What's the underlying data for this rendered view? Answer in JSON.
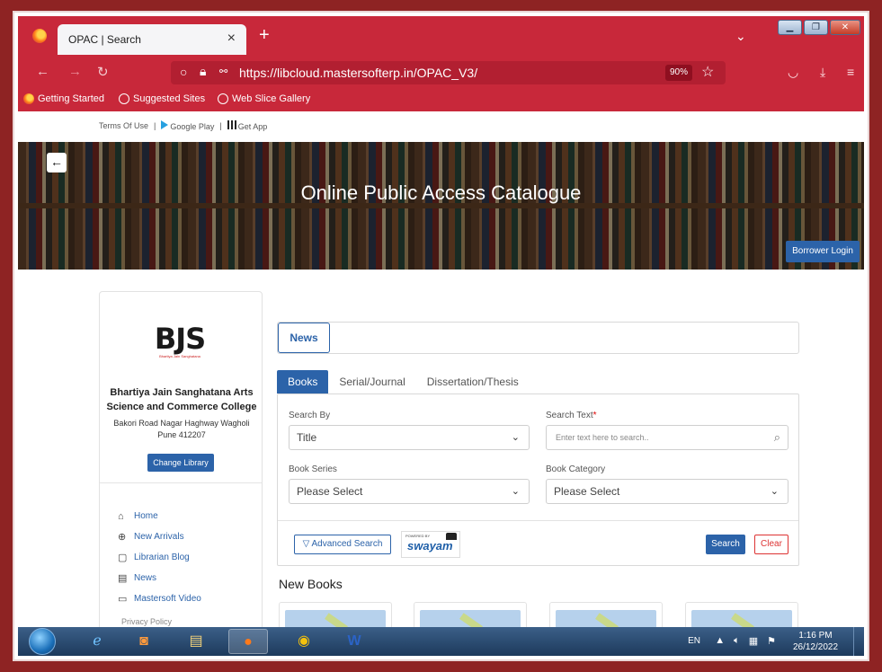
{
  "browser": {
    "tab_title": "OPAC | Search",
    "tab_close": "×",
    "new_tab": "+",
    "url": "https://libcloud.mastersofterp.in/OPAC_V3/",
    "zoom": "90%",
    "bookmarks": [
      "Getting Started",
      "Suggested Sites",
      "Web Slice Gallery"
    ],
    "colors": {
      "chrome": "#c8283a",
      "url_bg": "#b21f31"
    }
  },
  "topbar": {
    "terms": "Terms Of Use",
    "separator": "|",
    "google_play": "Google Play",
    "get_app": "Get App"
  },
  "hero": {
    "title": "Online Public Access Catalogue",
    "back": "←",
    "borrower_login": "Borrower Login"
  },
  "sidebar": {
    "logo_text": "BJS",
    "logo_sub": "Bhartiya Jain Sanghatana",
    "college_name": "Bhartiya Jain Sanghatana Arts Science and Commerce College",
    "address": "Bakori Road Nagar Haghway Wagholi Pune 412207",
    "change_library": "Change Library",
    "nav": [
      {
        "icon": "home-icon",
        "glyph": "⌂",
        "label": "Home"
      },
      {
        "icon": "new-arrivals-icon",
        "glyph": "⊕",
        "label": "New Arrivals"
      },
      {
        "icon": "blog-icon",
        "glyph": "▢",
        "label": "Librarian Blog"
      },
      {
        "icon": "news-icon",
        "glyph": "▤",
        "label": "News"
      },
      {
        "icon": "video-icon",
        "glyph": "▭",
        "label": "Mastersoft Video"
      }
    ],
    "privacy": "Privacy Policy"
  },
  "news": {
    "tab": "News"
  },
  "search": {
    "tabs": [
      "Books",
      "Serial/Journal",
      "Dissertation/Thesis"
    ],
    "search_by_label": "Search By",
    "search_by_value": "Title",
    "search_text_label": "Search Text",
    "required_mark": "*",
    "search_text_placeholder": "Enter text here to search..",
    "book_series_label": "Book Series",
    "book_series_value": "Please Select",
    "book_category_label": "Book Category",
    "book_category_value": "Please Select",
    "advanced_search": "Advanced Search",
    "swayam_powered": "POWERED BY",
    "swayam": "swayam",
    "search_button": "Search",
    "clear_button": "Clear"
  },
  "new_books": {
    "title": "New Books"
  },
  "taskbar": {
    "lang": "EN",
    "time": "1:16 PM",
    "date": "26/12/2022"
  }
}
